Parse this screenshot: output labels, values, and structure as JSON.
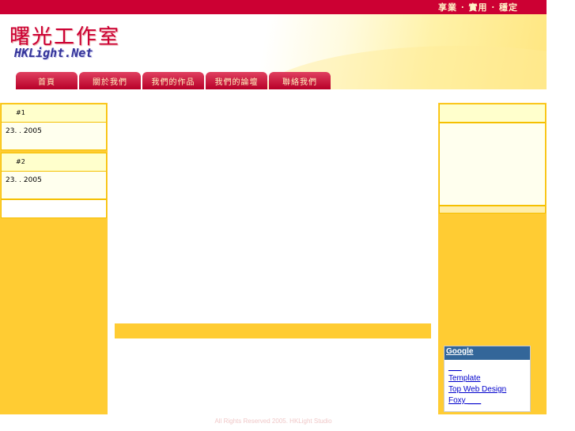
{
  "header": {
    "tagline": "享業 · 實用 · 穩定",
    "site_title": "曙光工作室",
    "site_subtitle": "HKLight.Net"
  },
  "nav": {
    "items": [
      {
        "label": "首頁"
      },
      {
        "label": "關於我們"
      },
      {
        "label": "我們的作品"
      },
      {
        "label": "我們的論壇"
      },
      {
        "label": "聯絡我們"
      }
    ]
  },
  "news": [
    {
      "title": "#1",
      "date": "23.   . 2005"
    },
    {
      "title": "#2",
      "date": "23.   . 2005"
    }
  ],
  "google": {
    "title": "Google",
    "links": [
      "___",
      "Template",
      "Top Web Design",
      "Foxy ___"
    ]
  },
  "footer": {
    "text": "All Rights Reserved 2005. HKLight Studio"
  },
  "colors": {
    "brand_red": "#cc0033",
    "accent_yellow": "#ffcc33",
    "panel_light": "#ffffcc",
    "google_blue": "#336699"
  }
}
